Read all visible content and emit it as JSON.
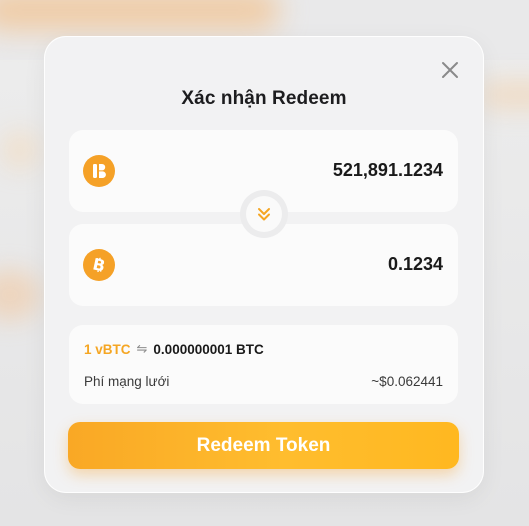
{
  "modal": {
    "title": "Xác nhận Redeem",
    "close_icon": "close-icon"
  },
  "from": {
    "token_icon": "vbtc-coin-icon",
    "amount": "521,891.1234"
  },
  "swap": {
    "icon": "double-chevron-down-icon"
  },
  "to": {
    "token_icon": "bitcoin-coin-icon",
    "amount": "0.1234"
  },
  "rate": {
    "from": "1 vBTC",
    "arrow": "⇋",
    "to": "0.000000001 BTC"
  },
  "fee": {
    "label": "Phí mạng lưới",
    "value": "~$0.062441"
  },
  "submit_label": "Redeem Token",
  "colors": {
    "accent": "#f5a623",
    "button_start": "#f9a825",
    "button_end": "#ffbd2e",
    "coin": "#f5a127"
  }
}
